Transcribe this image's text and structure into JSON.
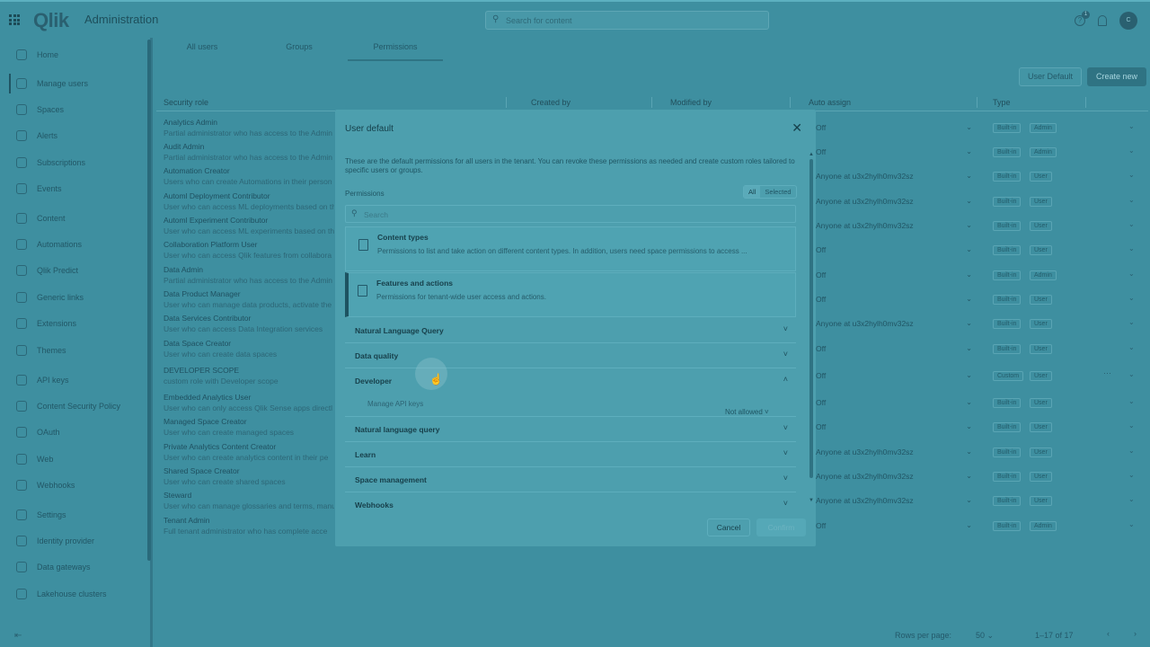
{
  "header": {
    "logo": "Qlik",
    "title": "Administration",
    "search_placeholder": "Search for content",
    "notifications": "1",
    "avatar": "C"
  },
  "sidebar": {
    "items": [
      {
        "label": "Home",
        "name": "sidebar-item-home",
        "icon": "home-icon"
      },
      {
        "label": "Manage users",
        "name": "sidebar-item-manage-users",
        "icon": "user-icon"
      },
      {
        "label": "Spaces",
        "name": "sidebar-item-spaces",
        "icon": "spaces-icon"
      },
      {
        "label": "Alerts",
        "name": "sidebar-item-alerts",
        "icon": "alert-icon"
      },
      {
        "label": "Subscriptions",
        "name": "sidebar-item-subscriptions",
        "icon": "mail-icon"
      },
      {
        "label": "Events",
        "name": "sidebar-item-events",
        "icon": "clock-icon"
      },
      {
        "label": "Content",
        "name": "sidebar-item-content",
        "icon": "content-icon"
      },
      {
        "label": "Automations",
        "name": "sidebar-item-automations",
        "icon": "automation-icon"
      },
      {
        "label": "Qlik Predict",
        "name": "sidebar-item-qlik-predict",
        "icon": "predict-icon"
      },
      {
        "label": "Generic links",
        "name": "sidebar-item-generic-links",
        "icon": "link-icon"
      },
      {
        "label": "Extensions",
        "name": "sidebar-item-extensions",
        "icon": "extension-icon"
      },
      {
        "label": "Themes",
        "name": "sidebar-item-themes",
        "icon": "theme-icon"
      },
      {
        "label": "API keys",
        "name": "sidebar-item-api-keys",
        "icon": "key-icon"
      },
      {
        "label": "Content Security Policy",
        "name": "sidebar-item-csp",
        "icon": "shield-icon"
      },
      {
        "label": "OAuth",
        "name": "sidebar-item-oauth",
        "icon": "oauth-icon"
      },
      {
        "label": "Web",
        "name": "sidebar-item-web",
        "icon": "globe-icon"
      },
      {
        "label": "Webhooks",
        "name": "sidebar-item-webhooks",
        "icon": "webhook-icon"
      },
      {
        "label": "Settings",
        "name": "sidebar-item-settings",
        "icon": "gear-icon"
      },
      {
        "label": "Identity provider",
        "name": "sidebar-item-identity-provider",
        "icon": "identity-icon"
      },
      {
        "label": "Data gateways",
        "name": "sidebar-item-data-gateways",
        "icon": "gateway-icon"
      },
      {
        "label": "Lakehouse clusters",
        "name": "sidebar-item-lakehouse-clusters",
        "icon": "cluster-icon"
      }
    ]
  },
  "tabs": [
    "All users",
    "Groups",
    "Permissions"
  ],
  "toolbar": {
    "user_default": "User Default",
    "create_new": "Create new"
  },
  "table": {
    "headers": [
      "Security role",
      "Created by",
      "Modified by",
      "Auto assign",
      "Type"
    ],
    "rows": [
      {
        "name": "Analytics Admin",
        "desc": "Partial administrator who has access to the Admin",
        "assign": "Off",
        "type": "Built-in",
        "role": "Admin"
      },
      {
        "name": "Audit Admin",
        "desc": "Partial administrator who has access to the Admin",
        "assign": "Off",
        "type": "Built-in",
        "role": "Admin"
      },
      {
        "name": "Automation Creator",
        "desc": "Users who can create Automations in their person",
        "assign": "Anyone at u3x2hylh0mv32sz",
        "type": "Built-in",
        "role": "User"
      },
      {
        "name": "Automl Deployment Contributor",
        "desc": "User who can access ML deployments based on th",
        "assign": "Anyone at u3x2hylh0mv32sz",
        "type": "Built-in",
        "role": "User"
      },
      {
        "name": "Automl Experiment Contributor",
        "desc": "User who can access ML experiments based on th",
        "assign": "Anyone at u3x2hylh0mv32sz",
        "type": "Built-in",
        "role": "User"
      },
      {
        "name": "Collaboration Platform User",
        "desc": "User who can access Qlik features from collabora",
        "assign": "Off",
        "type": "Built-in",
        "role": "User"
      },
      {
        "name": "Data Admin",
        "desc": "Partial administrator who has access to the Admin",
        "assign": "Off",
        "type": "Built-in",
        "role": "Admin"
      },
      {
        "name": "Data Product Manager",
        "desc": "User who can manage data products, activate the",
        "assign": "Off",
        "type": "Built-in",
        "role": "User"
      },
      {
        "name": "Data Services Contributor",
        "desc": "User who can access Data Integration services",
        "assign": "Anyone at u3x2hylh0mv32sz",
        "type": "Built-in",
        "role": "User"
      },
      {
        "name": "Data Space Creator",
        "desc": "User who can create data spaces",
        "assign": "Off",
        "type": "Built-in",
        "role": "User"
      },
      {
        "name": "DEVELOPER SCOPE",
        "desc": "custom role with Developer scope",
        "assign": "Off",
        "type": "Custom",
        "role": "User"
      },
      {
        "name": "Embedded Analytics User",
        "desc": "User who can only access Qlik Sense apps directl",
        "assign": "Off",
        "type": "Built-in",
        "role": "User"
      },
      {
        "name": "Managed Space Creator",
        "desc": "User who can create managed spaces",
        "assign": "Off",
        "type": "Built-in",
        "role": "User"
      },
      {
        "name": "Private Analytics Content Creator",
        "desc": "User who can create analytics content in their pe",
        "assign": "Anyone at u3x2hylh0mv32sz",
        "type": "Built-in",
        "role": "User"
      },
      {
        "name": "Shared Space Creator",
        "desc": "User who can create shared spaces",
        "assign": "Anyone at u3x2hylh0mv32sz",
        "type": "Built-in",
        "role": "User"
      },
      {
        "name": "Steward",
        "desc": "User who can manage glossaries and terms, manu",
        "assign": "Anyone at u3x2hylh0mv32sz",
        "type": "Built-in",
        "role": "User"
      },
      {
        "name": "Tenant Admin",
        "desc": "Full tenant administrator who has complete acce",
        "assign": "Off",
        "type": "Built-in",
        "role": "Admin"
      }
    ]
  },
  "footer": {
    "rows_per_page_label": "Rows per page:",
    "rows_per_page": "50",
    "range": "1–17 of 17"
  },
  "modal": {
    "title": "User default",
    "description": "These are the default permissions for all users in the tenant. You can revoke these permissions as needed and create custom roles tailored to specific users or groups.",
    "permissions_label": "Permissions",
    "filter": {
      "all": "All",
      "selected": "Selected"
    },
    "search_placeholder": "Search",
    "categories": [
      {
        "title": "Content types",
        "desc": "Permissions to list and take action on different content types. In addition, users need space permissions to access ..."
      },
      {
        "title": "Features and actions",
        "desc": "Permissions for tenant-wide user access and actions."
      }
    ],
    "accordions": [
      "Natural Language Query",
      "Data quality",
      "Developer",
      "Natural language query",
      "Learn",
      "Space management",
      "Webhooks"
    ],
    "developer_sub": {
      "label": "Manage API keys",
      "value": "Not allowed"
    },
    "cancel": "Cancel",
    "confirm": "Confirm"
  }
}
